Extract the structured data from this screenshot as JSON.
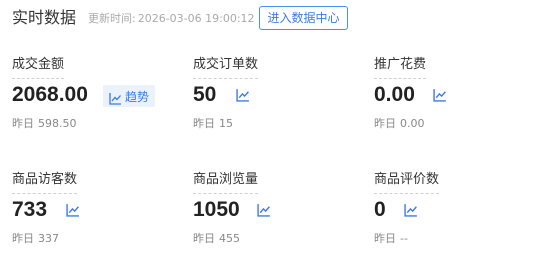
{
  "header": {
    "title": "实时数据",
    "update_prefix": "更新时间:",
    "update_time": "2026-03-06 19:00:12",
    "enter_button": "进入数据中心"
  },
  "colors": {
    "accent": "#3a7be8",
    "trend_pill_bg": "#eaf2fd",
    "muted_text": "#888888"
  },
  "metrics": [
    {
      "label": "成交金额",
      "value": "2068.00",
      "yesterday_label": "昨日",
      "yesterday_value": "598.50",
      "trend_label": "趋势",
      "icon": "trend-chart-icon"
    },
    {
      "label": "成交订单数",
      "value": "50",
      "yesterday_label": "昨日",
      "yesterday_value": "15",
      "icon": "trend-chart-icon"
    },
    {
      "label": "推广花费",
      "value": "0.00",
      "yesterday_label": "昨日",
      "yesterday_value": "0.00",
      "icon": "trend-chart-icon"
    },
    {
      "label": "商品访客数",
      "value": "733",
      "yesterday_label": "昨日",
      "yesterday_value": "337",
      "icon": "trend-chart-icon"
    },
    {
      "label": "商品浏览量",
      "value": "1050",
      "yesterday_label": "昨日",
      "yesterday_value": "455",
      "icon": "trend-chart-icon"
    },
    {
      "label": "商品评价数",
      "value": "0",
      "yesterday_label": "昨日",
      "yesterday_value": "--",
      "icon": "trend-chart-icon"
    }
  ]
}
